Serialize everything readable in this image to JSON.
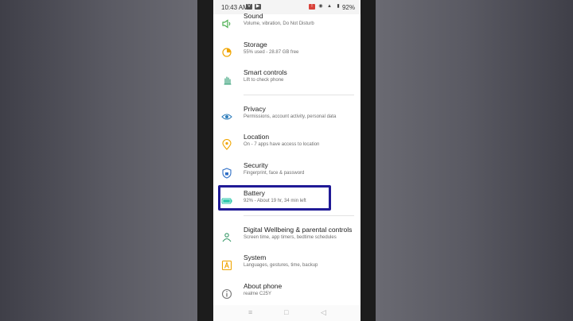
{
  "status_bar": {
    "time": "10:43 AM",
    "battery_percent": "92%"
  },
  "items": [
    {
      "key": "sound",
      "title": "Sound",
      "subtitle": "Volume, vibration, Do Not Disturb",
      "icon": "speaker-icon",
      "color": "#4caf50"
    },
    {
      "key": "storage",
      "title": "Storage",
      "subtitle": "55% used - 28.87 GB free",
      "icon": "storage-pie-icon",
      "color": "#f0a500"
    },
    {
      "key": "smart-controls",
      "title": "Smart controls",
      "subtitle": "Lift to check phone",
      "icon": "hand-gesture-icon",
      "color": "#2e9d72"
    },
    {
      "key": "privacy",
      "title": "Privacy",
      "subtitle": "Permissions, account activity, personal data",
      "icon": "privacy-eye-icon",
      "color": "#2f7ebc"
    },
    {
      "key": "location",
      "title": "Location",
      "subtitle": "On - 7 apps have access to location",
      "icon": "location-pin-icon",
      "color": "#f0a500"
    },
    {
      "key": "security",
      "title": "Security",
      "subtitle": "Fingerprint, face & password",
      "icon": "shield-icon",
      "color": "#2f6fc6"
    },
    {
      "key": "battery",
      "title": "Battery",
      "subtitle": "92% - About 19 hr, 34 min left",
      "icon": "battery-icon",
      "color": "#25c6a8"
    },
    {
      "key": "digital-wellbeing",
      "title": "Digital Wellbeing & parental controls",
      "subtitle": "Screen time, app timers, bedtime schedules",
      "icon": "wellbeing-icon",
      "color": "#3a9a6a"
    },
    {
      "key": "system",
      "title": "System",
      "subtitle": "Languages, gestures, time, backup",
      "icon": "system-a-icon",
      "color": "#f0a500"
    },
    {
      "key": "about-phone",
      "title": "About phone",
      "subtitle": "realme C25Y",
      "icon": "info-icon",
      "color": "#777777"
    }
  ],
  "colors": {
    "highlight_box": "#201a96",
    "screen_background": "#ffffff"
  }
}
